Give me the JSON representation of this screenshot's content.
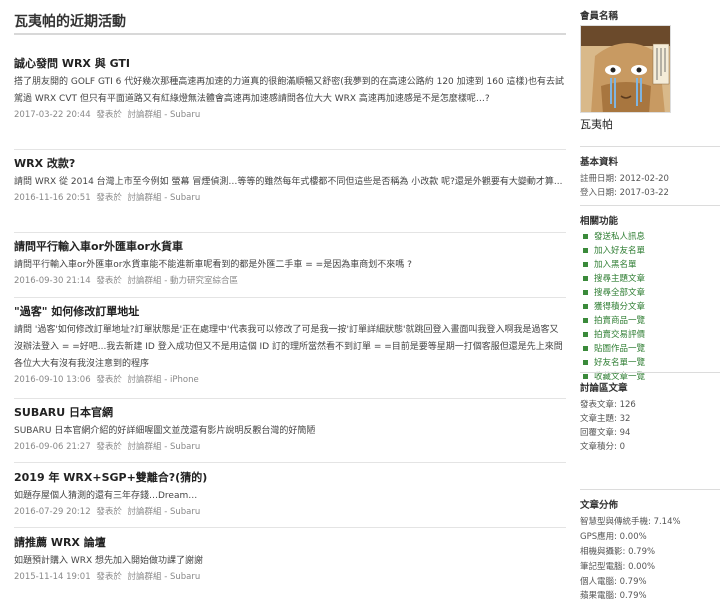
{
  "page": {
    "title": "瓦夷帕的近期活動"
  },
  "posts": [
    {
      "title": "誠心發問 WRX 與 GTI",
      "body": "搭了朋友開的 GOLF GTI 6 代好幾次那種高速再加速的力道真的很飽滿順暢又舒密(我夢到的在高速公路約 120 加速到 160 這樣)也有去試駕過 WRX CVT 但只有平面道路又有紅綠燈無法體會高速再加速感請問各位大大 WRX 高速再加速感是不是怎麼樣呢…?",
      "date": "2017-03-22 20:44",
      "posted_in": "發表於",
      "forum": "討論群組 - Subaru"
    },
    {
      "title": "WRX 改款?",
      "body": "請問 WRX 從 2014 台灣上市至今例如 螢幕 冒煙偵測…等等的雖然每年式樓都不同但這些是否稱為 小改款 呢?還是外觀要有大變動才算...",
      "date": "2016-11-16 20:51",
      "posted_in": "發表於",
      "forum": "討論群組 - Subaru"
    },
    {
      "title": "請問平行輸入車or外匯車or水貨車",
      "body": "請問平行輸入車or外匯車or水貨車能不能進新車呢看到的都是外匯二手車 = =是因為車商划不來嗎 ?",
      "date": "2016-09-30 21:14",
      "posted_in": "發表於",
      "forum": "討論群組 - 動力研究室綜合區"
    },
    {
      "title": "\"過客\" 如何修改訂單地址",
      "body": "請問 '過客'如何修改訂單地址?訂單狀態是'正在處理中'代表我可以修改了可是我一按'訂單詳細狀態'就跳回登入畫面叫我登入啊我是過客又沒辦法登入 = =好吧...我去新建 ID 登入成功但又不是用這個 ID 訂的理所當然看不到訂單 = =目前是要等星期一打個客服但還是先上來問各位大大有沒有我沒注意到的程序",
      "date": "2016-09-10 13:06",
      "posted_in": "發表於",
      "forum": "討論群組 - iPhone"
    },
    {
      "title": "SUBARU 日本官網",
      "body": "SUBARU 日本官網介紹的好詳細喔圖文並茂還有影片說明反觀台灣的好簡陋",
      "date": "2016-09-06 21:27",
      "posted_in": "發表於",
      "forum": "討論群組 - Subaru"
    },
    {
      "title": "2019 年 WRX+SGP+雙離合?(猜的)",
      "body": "如題存屋個人猜測的還有三年存錢…Dream…",
      "date": "2016-07-29 20:12",
      "posted_in": "發表於",
      "forum": "討論群組 - Subaru"
    },
    {
      "title": "請推薦 WRX 論壇",
      "body": "如題預計購入 WRX 想先加入開始做功課了謝謝",
      "date": "2015-11-14 19:01",
      "posted_in": "發表於",
      "forum": "討論群組 - Subaru"
    }
  ],
  "sidebar": {
    "member_name_heading": "會員名稱",
    "username": "瓦夷帕",
    "basic_info_heading": "基本資料",
    "register_date": "註冊日期: 2012-02-20",
    "login_date": "登入日期: 2017-03-22",
    "functions_heading": "相關功能",
    "functions": [
      "發送私人訊息",
      "加入好友名單",
      "加入黑名單",
      "搜尋主題文章",
      "搜尋全部文章",
      "獲得積分文章",
      "拍賣商品一覽",
      "拍賣交易評價",
      "貼圖作品一覽",
      "好友名單一覽",
      "收藏文章一覽"
    ],
    "forum_posts_heading": "討論區文章",
    "forum_stats": [
      "發表文章: 126",
      "文章主題: 32",
      "回覆文章: 94",
      "文章積分: 0"
    ],
    "distribution_heading": "文章分佈",
    "distribution": [
      "智慧型與傳統手機: 7.14%",
      "GPS應用: 0.00%",
      "相機與攝影: 0.79%",
      "筆記型電腦: 0.00%",
      "個人電腦: 0.79%",
      "蘋果電腦: 0.79%"
    ]
  },
  "colors": {
    "link_green": "#2e7d32",
    "meta_gray": "#888888",
    "rule_gray": "#d8d8d8"
  }
}
